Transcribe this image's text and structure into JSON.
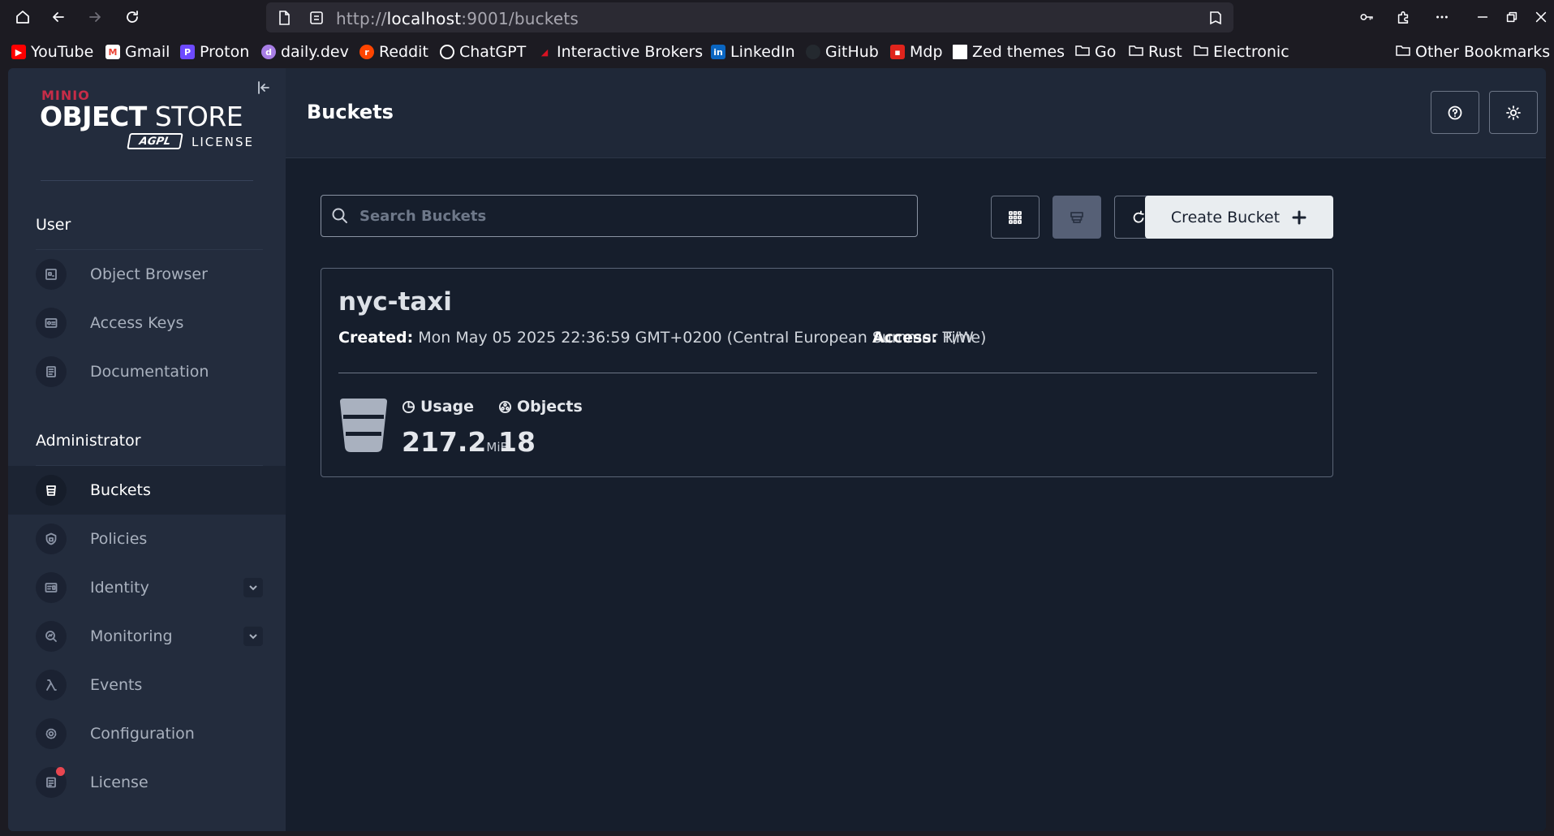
{
  "browser": {
    "url_prefix": "http://",
    "url_host": "localhost",
    "url_rest": ":9001/buckets",
    "bookmarks": [
      {
        "label": "YouTube",
        "icon": "youtube-icon",
        "color": "#ff0000"
      },
      {
        "label": "Gmail",
        "icon": "gmail-icon",
        "color": "#ea4335"
      },
      {
        "label": "Proton",
        "icon": "proton-icon",
        "color": "#6d4aff"
      },
      {
        "label": "daily.dev",
        "icon": "dailydev-icon",
        "color": "#a87ee6"
      },
      {
        "label": "Reddit",
        "icon": "reddit-icon",
        "color": "#ff4500"
      },
      {
        "label": "ChatGPT",
        "icon": "chatgpt-icon",
        "color": "#ffffff"
      },
      {
        "label": "Interactive Brokers",
        "icon": "ibkr-icon",
        "color": "#d81222"
      },
      {
        "label": "LinkedIn",
        "icon": "linkedin-icon",
        "color": "#0a66c2"
      },
      {
        "label": "GitHub",
        "icon": "github-icon",
        "color": "#24292f"
      },
      {
        "label": "Mdp",
        "icon": "lock-icon",
        "color": "#e0241c"
      },
      {
        "label": "Zed themes",
        "icon": "page-icon",
        "color": "#ffffff"
      },
      {
        "label": "Go",
        "icon": "folder-icon"
      },
      {
        "label": "Rust",
        "icon": "folder-icon"
      },
      {
        "label": "Electronic",
        "icon": "folder-icon"
      }
    ],
    "other_bookmarks": "Other Bookmarks"
  },
  "logo": {
    "brand": "MINIO",
    "product_bold": "OBJECT",
    "product_light": " STORE",
    "agpl": "AGPL",
    "license": "LICENSE"
  },
  "sidebar": {
    "user_title": "User",
    "user_items": [
      {
        "label": "Object Browser",
        "icon": "object-browser-icon"
      },
      {
        "label": "Access Keys",
        "icon": "access-keys-icon"
      },
      {
        "label": "Documentation",
        "icon": "documentation-icon"
      }
    ],
    "admin_title": "Administrator",
    "admin_items": [
      {
        "label": "Buckets",
        "icon": "bucket-icon",
        "active": true
      },
      {
        "label": "Policies",
        "icon": "policies-icon"
      },
      {
        "label": "Identity",
        "icon": "identity-icon",
        "expandable": true
      },
      {
        "label": "Monitoring",
        "icon": "monitoring-icon",
        "expandable": true
      },
      {
        "label": "Events",
        "icon": "lambda-icon"
      },
      {
        "label": "Configuration",
        "icon": "gear-icon"
      },
      {
        "label": "License",
        "icon": "license-icon",
        "badge": true
      }
    ]
  },
  "header": {
    "title": "Buckets"
  },
  "toolbar": {
    "search_placeholder": "Search Buckets",
    "create_label": "Create Bucket"
  },
  "bucket": {
    "name": "nyc-taxi",
    "created_label": "Created:",
    "created_value": " Mon May 05 2025 22:36:59 GMT+0200 (Central European Summer Time)",
    "access_label": "Access:",
    "access_value": " R/W",
    "usage_label": "Usage",
    "usage_value": "217.2",
    "usage_unit": "MiB",
    "objects_label": "Objects",
    "objects_value": "18"
  }
}
